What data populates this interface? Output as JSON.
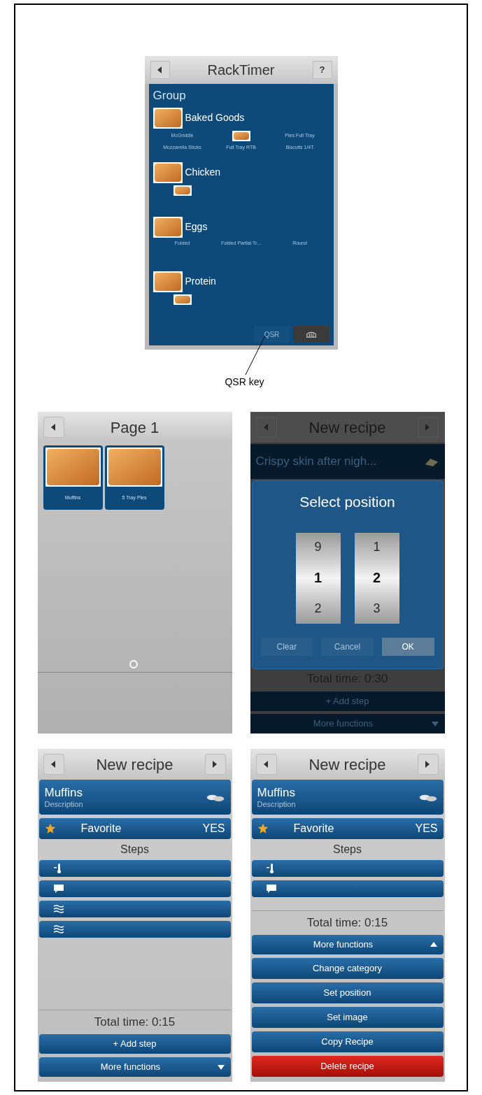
{
  "rack_timer": {
    "title": "RackTimer",
    "help": "?",
    "group_title": "Group",
    "categories": [
      {
        "name": "Baked Goods",
        "items": [
          {
            "kind": "text",
            "label": "McGriddle"
          },
          {
            "kind": "image"
          },
          {
            "kind": "text",
            "label": "Pies Full Tray"
          },
          {
            "kind": "text",
            "label": "Mozzarella Sticks"
          },
          {
            "kind": "text",
            "label": "Full Tray RTB"
          },
          {
            "kind": "text",
            "label": "Biscuits 1/4T"
          }
        ]
      },
      {
        "name": "Chicken",
        "items": [
          {
            "kind": "image"
          }
        ]
      },
      {
        "name": "Eggs",
        "items": [
          {
            "kind": "text",
            "label": "Folded"
          },
          {
            "kind": "text",
            "label": "Folded Partial Tr..."
          },
          {
            "kind": "text",
            "label": "Round"
          }
        ]
      },
      {
        "name": "Protein",
        "items": [
          {
            "kind": "image"
          }
        ]
      }
    ],
    "footer_button": "QSR"
  },
  "callout": {
    "label": "QSR key"
  },
  "page_screen": {
    "title": "Page 1",
    "tiles": [
      {
        "label": "Muffins"
      },
      {
        "label": "5 Tray Pies"
      }
    ]
  },
  "position_screen": {
    "title": "New recipe",
    "recipe_name": "Crispy skin after nigh...",
    "dialog": {
      "title": "Select position",
      "wheels": [
        {
          "values": [
            "9",
            "1",
            "2"
          ]
        },
        {
          "values": [
            "1",
            "2",
            "3"
          ]
        }
      ],
      "buttons": [
        {
          "label": "Clear",
          "primary": false
        },
        {
          "label": "Cancel",
          "primary": false
        },
        {
          "label": "OK",
          "primary": true
        }
      ]
    },
    "total_time": "Total time: 0:30",
    "add_step": "+ Add step",
    "more_functions": "More functions"
  },
  "recipe_screens": [
    {
      "title": "New recipe",
      "name": "Muffins",
      "description": "Description",
      "favorite": {
        "label": "Favorite",
        "value": "YES"
      },
      "steps_title": "Steps",
      "steps": [
        {
          "kind": "probe"
        },
        {
          "kind": "message"
        },
        {
          "kind": "fan"
        },
        {
          "kind": "fan"
        }
      ],
      "total_time": "Total time: 0:15",
      "add_step": "+ Add step",
      "more_functions": {
        "label": "More functions",
        "expanded": false
      }
    },
    {
      "title": "New recipe",
      "name": "Muffins",
      "description": "Description",
      "favorite": {
        "label": "Favorite",
        "value": "YES"
      },
      "steps_title": "Steps",
      "steps": [
        {
          "kind": "probe"
        },
        {
          "kind": "message"
        }
      ],
      "total_time": "Total time: 0:15",
      "more_functions": {
        "label": "More functions",
        "expanded": true,
        "items": [
          {
            "label": "Change category",
            "kind": "normal"
          },
          {
            "label": "Set position",
            "kind": "normal"
          },
          {
            "label": "Set image",
            "kind": "normal"
          },
          {
            "label": "Copy Recipe",
            "kind": "normal"
          },
          {
            "label": "Delete recipe",
            "kind": "danger"
          }
        ]
      }
    }
  ]
}
